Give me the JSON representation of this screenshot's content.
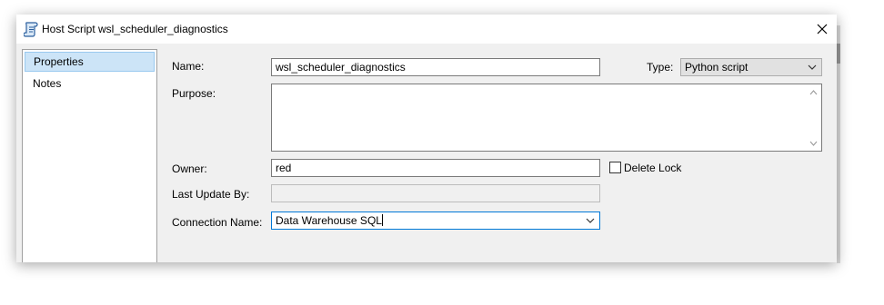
{
  "window": {
    "title": "Host Script wsl_scheduler_diagnostics"
  },
  "sidebar": {
    "items": [
      {
        "label": "Properties",
        "selected": true
      },
      {
        "label": "Notes",
        "selected": false
      }
    ]
  },
  "form": {
    "name_label": "Name:",
    "name_value": "wsl_scheduler_diagnostics",
    "type_label": "Type:",
    "type_value": "Python script",
    "purpose_label": "Purpose:",
    "purpose_value": "",
    "owner_label": "Owner:",
    "owner_value": "red",
    "delete_lock_label": "Delete Lock",
    "delete_lock_checked": false,
    "last_update_label": "Last Update By:",
    "last_update_value": "",
    "connection_label": "Connection Name:",
    "connection_value": "Data Warehouse SQL"
  },
  "icons": {
    "app": "script-scroll-icon",
    "close": "close-icon",
    "chevron": "chevron-down-icon",
    "scroll_up": "scroll-up-arrow-icon",
    "scroll_down": "scroll-down-arrow-icon"
  },
  "colors": {
    "selection_bg": "#cce4f7",
    "selection_border": "#99c9ef",
    "focus_border": "#0078d7",
    "dialog_bg": "#f0f0f0"
  }
}
